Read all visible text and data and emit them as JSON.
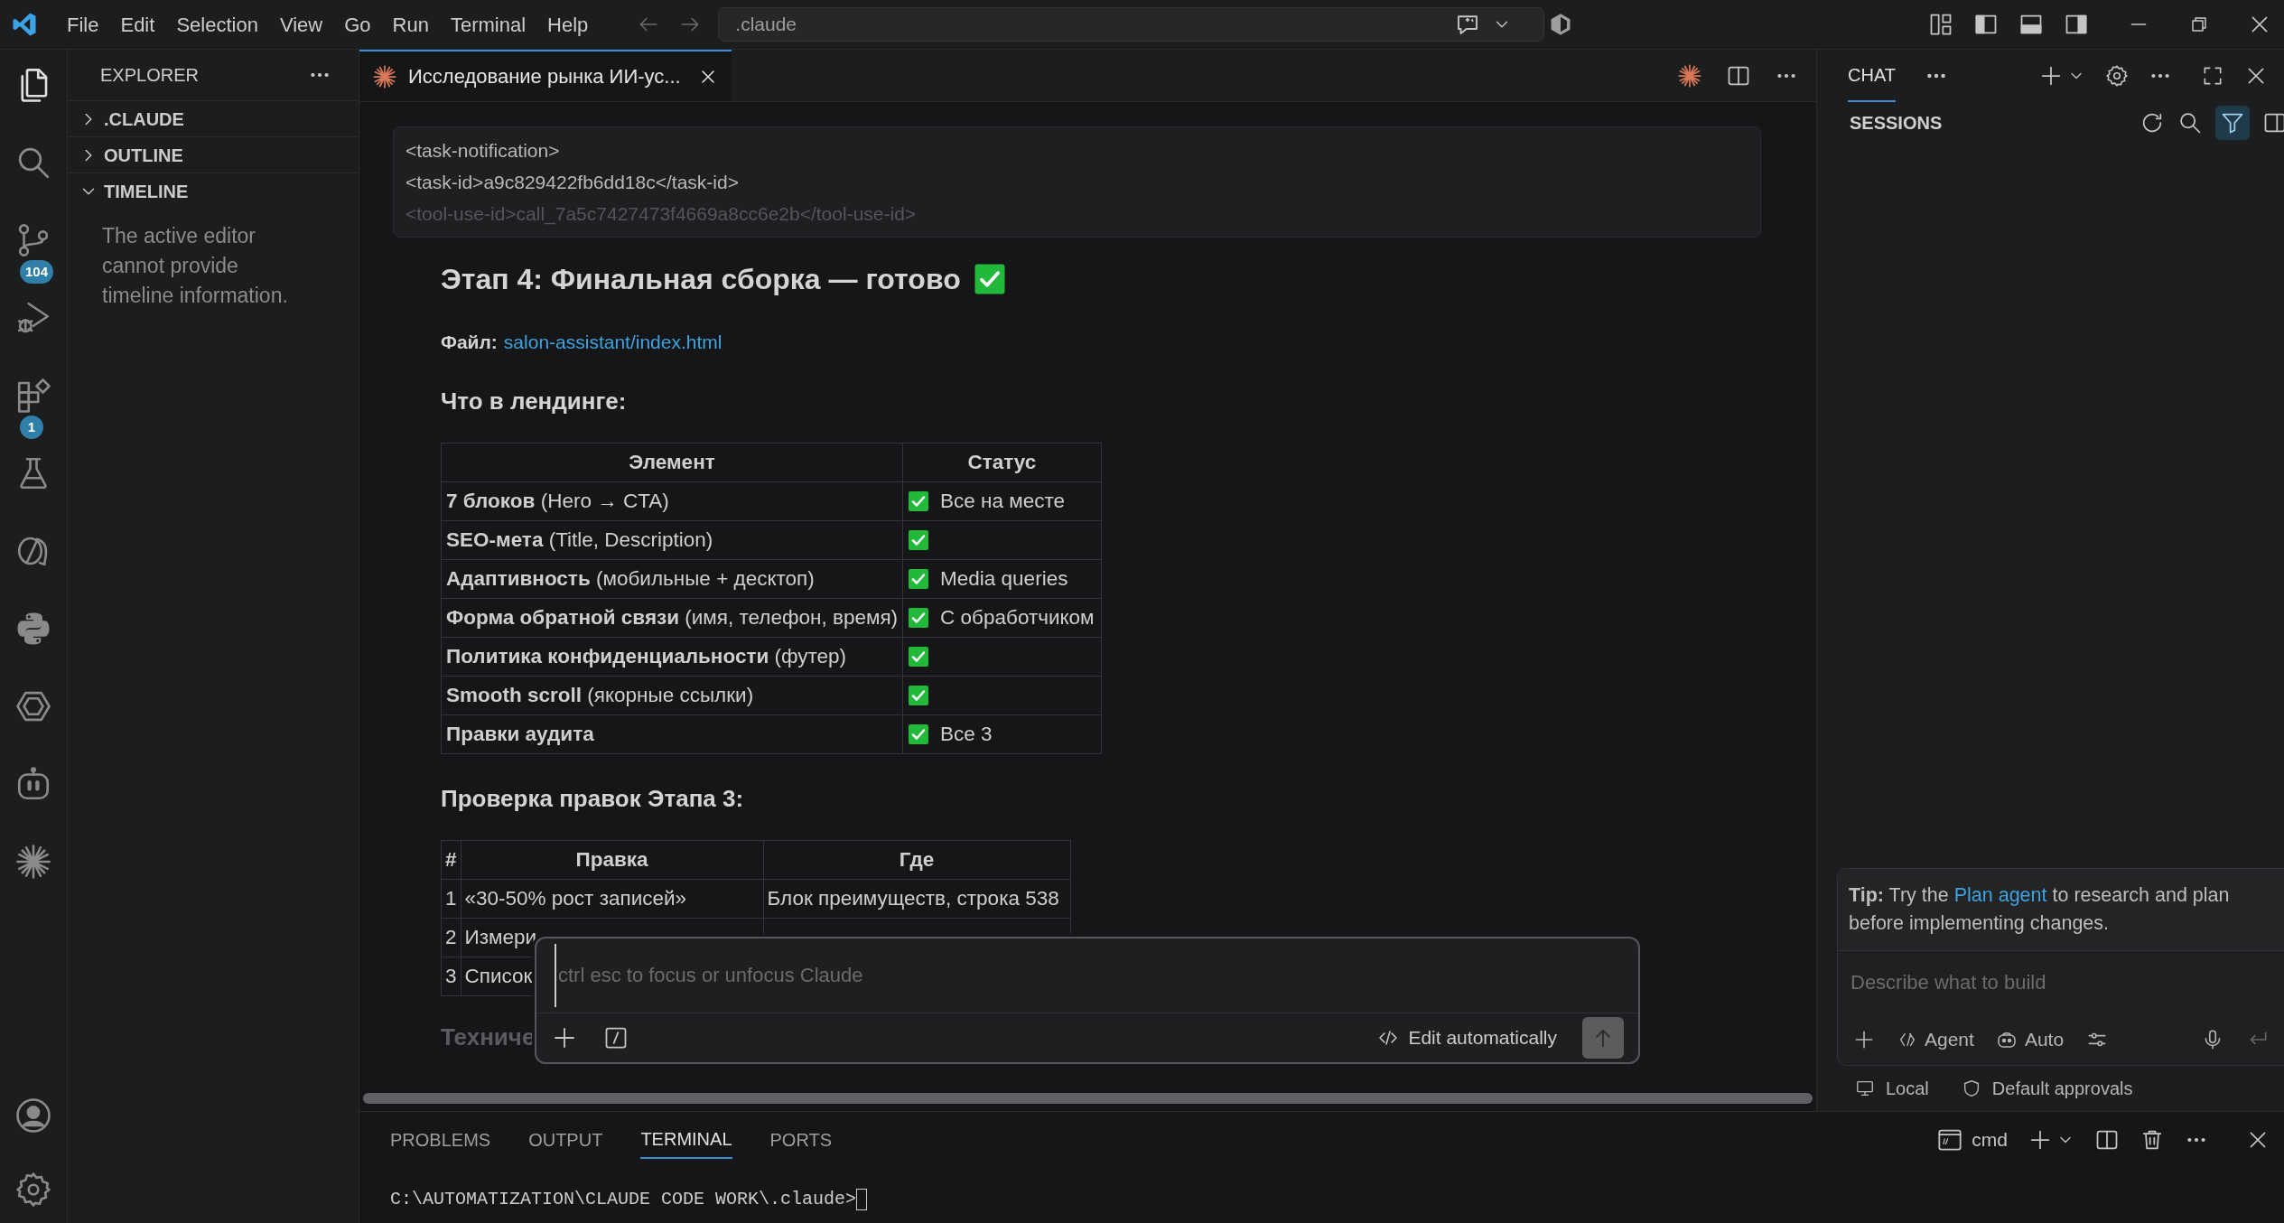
{
  "menu": [
    "File",
    "Edit",
    "Selection",
    "View",
    "Go",
    "Run",
    "Terminal",
    "Help"
  ],
  "command_center": ".claude",
  "activity_bar": [
    {
      "kind": "files",
      "selected": true
    },
    {
      "kind": "search",
      "selected": false
    },
    {
      "kind": "source-control",
      "badge": "104",
      "selected": false
    },
    {
      "kind": "run",
      "selected": false
    },
    {
      "kind": "extensions",
      "badge": "1",
      "selected": false
    },
    {
      "kind": "flask",
      "selected": false
    },
    {
      "kind": "bubbles",
      "selected": false
    },
    {
      "kind": "python",
      "selected": false
    },
    {
      "kind": "hexagon",
      "selected": false
    },
    {
      "kind": "robot",
      "selected": false
    },
    {
      "kind": "burst",
      "selected": false
    }
  ],
  "activity_bar_bottom": [
    {
      "kind": "account"
    },
    {
      "kind": "settings"
    }
  ],
  "sidebar": {
    "title": "EXPLORER",
    "sections": [
      {
        "label": ".CLAUDE",
        "expanded": false
      },
      {
        "label": "OUTLINE",
        "expanded": false
      },
      {
        "label": "TIMELINE",
        "expanded": true,
        "message": "The active editor cannot provide timeline information."
      }
    ]
  },
  "editor": {
    "tabs": [
      {
        "label": "Исследование рынка ИИ-ус...",
        "selected": true
      }
    ],
    "notification_lines": [
      "<task-notification>",
      "<task-id>a9c829422fb6dd18c</task-id>",
      "<tool-use-id>call_7a5c7427473f4669a8cc6e2b</tool-use-id>"
    ],
    "heading": {
      "text": "Этап 4: Финальная сборка — готово",
      "done": true
    },
    "file_label": "Файл:",
    "file_link": "salon-assistant/index.html",
    "section_1": "Что в лендинге:",
    "table_1": {
      "columns": [
        "Элемент",
        "Статус"
      ],
      "rows": [
        {
          "element": "**7 блоков** (Hero → CTA)",
          "done": true,
          "status": "Все на месте"
        },
        {
          "element": "**SEO-мета** (Title, Description)",
          "done": true
        },
        {
          "element": "**Адаптивность** (мобильные + десктоп)",
          "done": true,
          "status": "Media queries"
        },
        {
          "element": "**Форма обратной связи** (имя, телефон, время)",
          "done": true,
          "status": "С обработчиком"
        },
        {
          "element": "**Политика конфиденциальности** (футер)",
          "done": true
        },
        {
          "element": "**Smooth scroll** (якорные ссылки)",
          "done": true
        },
        {
          "element": "**Правки аудита**",
          "done": true,
          "status": "Все 3"
        }
      ]
    },
    "section_2": "Проверка правок Этапа 3:",
    "table_2": {
      "columns": [
        "#",
        "Правка",
        "Где"
      ],
      "rows": [
        [
          "1",
          "«30-50% рост записей»",
          "Блок преимуществ, строка 538"
        ],
        [
          "2",
          "Измери"
        ],
        [
          "3",
          "Список"
        ]
      ]
    },
    "section_3": "Техниче",
    "composer": {
      "placeholder": "ctrl esc to focus or unfocus Claude",
      "mode": "Edit automatically"
    }
  },
  "chat": {
    "tab": "CHAT",
    "sessions": "SESSIONS",
    "filter_on": true,
    "tip": {
      "before": "**Tip:** Try the",
      "link": "Plan agent",
      "after": "to research and plan before implementing changes."
    },
    "placeholder": "Describe what to build",
    "agent": "Agent",
    "model": "Auto",
    "footer": [
      "Local",
      "Default approvals"
    ]
  },
  "panel": {
    "tabs": [
      {
        "label": "PROBLEMS",
        "selected": false
      },
      {
        "label": "OUTPUT",
        "selected": false
      },
      {
        "label": "TERMINAL",
        "selected": true
      },
      {
        "label": "PORTS",
        "selected": false
      }
    ],
    "terminal_name": "cmd",
    "terminal_line": "C:\\AUTOMATIZATION\\CLAUDE CODE WORK\\.claude>"
  }
}
